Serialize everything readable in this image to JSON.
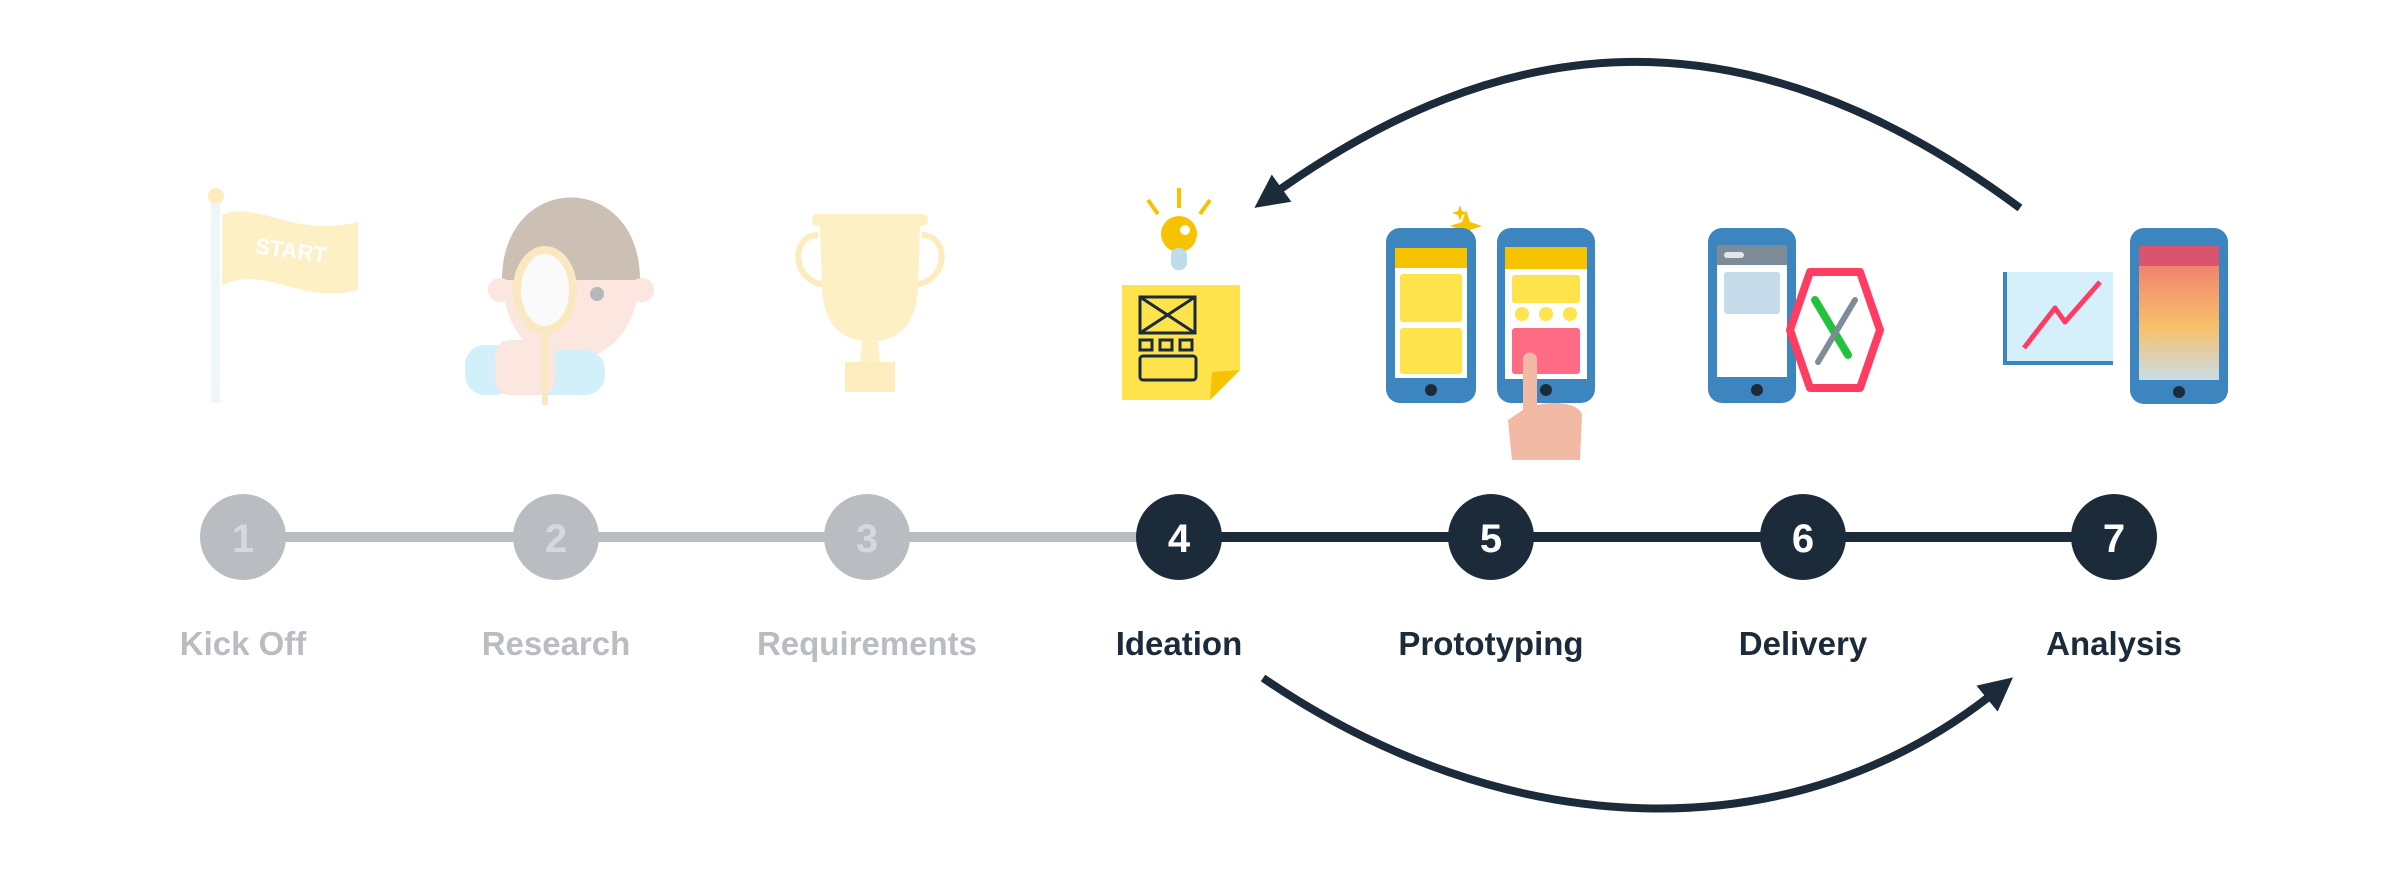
{
  "colors": {
    "active": "#1c2b3a",
    "inactive": "#b9bcc1",
    "inactive_text": "#b9bcc1",
    "inactive_num": "#d5d8dc"
  },
  "steps": [
    {
      "number": "1",
      "label": "Kick Off",
      "active": false,
      "icon": "start-flag-icon"
    },
    {
      "number": "2",
      "label": "Research",
      "active": false,
      "icon": "researcher-magnifier-icon"
    },
    {
      "number": "3",
      "label": "Requirements",
      "active": false,
      "icon": "trophy-icon"
    },
    {
      "number": "4",
      "label": "Ideation",
      "active": true,
      "icon": "lightbulb-sticky-note-icon"
    },
    {
      "number": "5",
      "label": "Prototyping",
      "active": true,
      "icon": "phones-tap-icon"
    },
    {
      "number": "6",
      "label": "Delivery",
      "active": true,
      "icon": "phone-tools-icon"
    },
    {
      "number": "7",
      "label": "Analysis",
      "active": true,
      "icon": "chart-phone-icon"
    }
  ],
  "flag_text": "START",
  "loop_arrows": [
    {
      "from": "Analysis",
      "to": "Ideation",
      "direction": "back"
    },
    {
      "from": "Ideation",
      "to": "Analysis",
      "direction": "forward"
    }
  ]
}
